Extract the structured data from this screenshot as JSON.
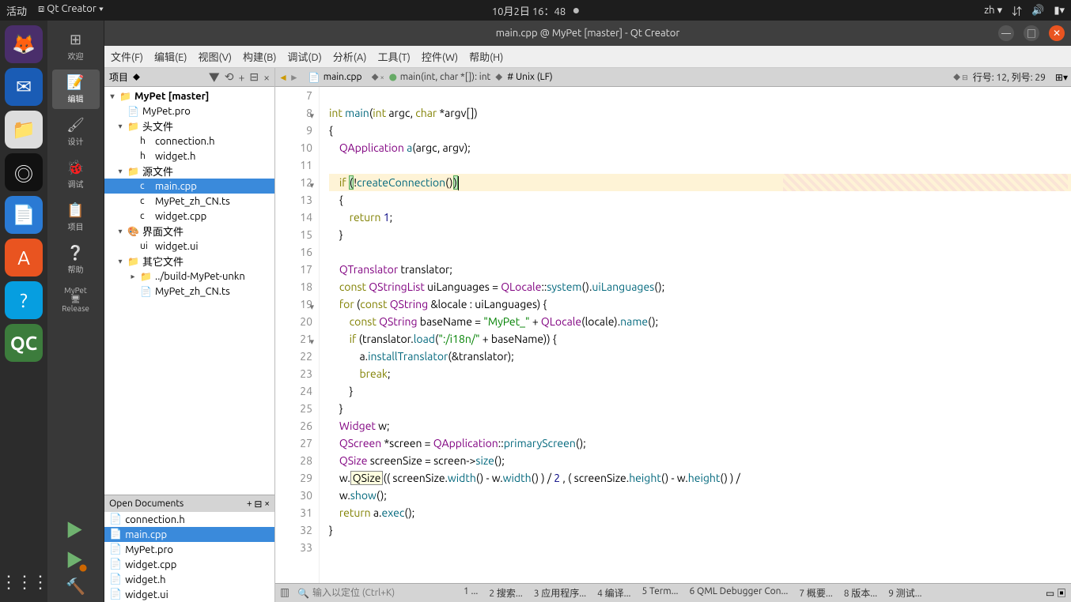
{
  "system": {
    "activities": "活动",
    "app_label": "Qt Creator ▾",
    "datetime": "10月2日  16：48",
    "lang": "zh ▾"
  },
  "window": {
    "title": "main.cpp @ MyPet [master] - Qt Creator"
  },
  "menu": [
    "文件(F)",
    "编辑(E)",
    "视图(V)",
    "构建(B)",
    "调试(D)",
    "分析(A)",
    "工具(T)",
    "控件(W)",
    "帮助(H)"
  ],
  "modebar_items": [
    {
      "icon": "⊞",
      "label": "欢迎"
    },
    {
      "icon": "📝",
      "label": "编辑",
      "active": true
    },
    {
      "icon": "🖌",
      "label": "设计"
    },
    {
      "icon": "🐞",
      "label": "调试"
    },
    {
      "icon": "📋",
      "label": "项目"
    },
    {
      "icon": "❔",
      "label": "帮助"
    }
  ],
  "kit": {
    "name": "MyPet",
    "config": "Release"
  },
  "project_panel": {
    "header": "项目",
    "tree": [
      {
        "depth": 0,
        "arrow": "▾",
        "icon": "📁",
        "label": "MyPet [master]",
        "bold": true
      },
      {
        "depth": 1,
        "arrow": "",
        "icon": "📄",
        "label": "MyPet.pro"
      },
      {
        "depth": 1,
        "arrow": "▾",
        "icon": "📁",
        "label": "头文件"
      },
      {
        "depth": 2,
        "arrow": "",
        "icon": "h",
        "label": "connection.h"
      },
      {
        "depth": 2,
        "arrow": "",
        "icon": "h",
        "label": "widget.h"
      },
      {
        "depth": 1,
        "arrow": "▾",
        "icon": "📁",
        "label": "源文件"
      },
      {
        "depth": 2,
        "arrow": "",
        "icon": "c",
        "label": "main.cpp",
        "selected": true
      },
      {
        "depth": 2,
        "arrow": "",
        "icon": "c",
        "label": "MyPet_zh_CN.ts"
      },
      {
        "depth": 2,
        "arrow": "",
        "icon": "c",
        "label": "widget.cpp"
      },
      {
        "depth": 1,
        "arrow": "▾",
        "icon": "🎨",
        "label": "界面文件"
      },
      {
        "depth": 2,
        "arrow": "",
        "icon": "ui",
        "label": "widget.ui"
      },
      {
        "depth": 1,
        "arrow": "▾",
        "icon": "📁",
        "label": "其它文件"
      },
      {
        "depth": 2,
        "arrow": "▸",
        "icon": "📁",
        "label": "../build-MyPet-unkn"
      },
      {
        "depth": 2,
        "arrow": "",
        "icon": "📄",
        "label": "MyPet_zh_CN.ts"
      }
    ]
  },
  "open_docs": {
    "header": "Open Documents",
    "items": [
      {
        "label": "connection.h"
      },
      {
        "label": "main.cpp",
        "selected": true
      },
      {
        "label": "MyPet.pro"
      },
      {
        "label": "widget.cpp"
      },
      {
        "label": "widget.h"
      },
      {
        "label": "widget.ui"
      }
    ]
  },
  "editor_toolbar": {
    "filename": "main.cpp",
    "symbol": "main(int, char *[]): int",
    "encoding": "#  Unix (LF)",
    "position": "行号: 12, 列号: 29"
  },
  "code_lines": [
    {
      "n": 7,
      "html": ""
    },
    {
      "n": 8,
      "fold": "▾",
      "html": "<span class='kw'>int</span> <span class='func'>main</span>(<span class='kw'>int</span> argc, <span class='kw'>char</span> *argv[])"
    },
    {
      "n": 9,
      "html": "{"
    },
    {
      "n": 10,
      "html": "    <span class='type'>QApplication</span> <span class='func'>a</span>(argc, argv);"
    },
    {
      "n": 11,
      "html": ""
    },
    {
      "n": 12,
      "fold": "▾",
      "hl": true,
      "html": "    <span class='kw'>if</span> <span class='paren-hl'>(</span>!<span class='func'>createConnection</span>()<span class='paren-hl'>)</span><span class='caret'></span>"
    },
    {
      "n": 13,
      "html": "    {"
    },
    {
      "n": 14,
      "html": "        <span class='kw'>return</span> <span class='num'>1</span>;"
    },
    {
      "n": 15,
      "html": "    }"
    },
    {
      "n": 16,
      "html": ""
    },
    {
      "n": 17,
      "html": "    <span class='type'>QTranslator</span> translator;"
    },
    {
      "n": 18,
      "html": "    <span class='kw'>const</span> <span class='type'>QStringList</span> uiLanguages = <span class='type'>QLocale</span>::<span class='func'>system</span>().<span class='func'>uiLanguages</span>();"
    },
    {
      "n": 19,
      "fold": "▾",
      "html": "    <span class='kw'>for</span> (<span class='kw'>const</span> <span class='type'>QString</span> &locale : uiLanguages) {"
    },
    {
      "n": 20,
      "html": "        <span class='kw'>const</span> <span class='type'>QString</span> baseName = <span class='str'>\"MyPet_\"</span> + <span class='type'>QLocale</span>(locale).<span class='func'>name</span>();"
    },
    {
      "n": 21,
      "fold": "▾",
      "html": "        <span class='kw'>if</span> (translator.<span class='func'>load</span>(<span class='str'>\":/i18n/\"</span> + baseName)) {"
    },
    {
      "n": 22,
      "html": "            a.<span class='func'>installTranslator</span>(&translator);"
    },
    {
      "n": 23,
      "html": "            <span class='kw'>break</span>;"
    },
    {
      "n": 24,
      "html": "        }"
    },
    {
      "n": 25,
      "html": "    }"
    },
    {
      "n": 26,
      "html": "    <span class='type'>Widget</span> w;"
    },
    {
      "n": 27,
      "html": "    <span class='type'>QScreen</span> *screen = <span class='type'>QApplication</span>::<span class='func'>primaryScreen</span>();"
    },
    {
      "n": 28,
      "html": "    <span class='type'>QSize</span> screenSize = screen-><span class='func'>size</span>();"
    },
    {
      "n": 29,
      "html": "    w.<span style='border:1px solid #888;background:#ffffe0;padding:0 2px'>QSize</span>(( screenSize.<span class='func'>width</span>() - w.<span class='func'>width</span>() ) / <span class='num'>2</span> , ( screenSize.<span class='func'>height</span>() - w.<span class='func'>height</span>() ) /"
    },
    {
      "n": 30,
      "html": "    w.<span class='func'>show</span>();"
    },
    {
      "n": 31,
      "html": "    <span class='kw'>return</span> a.<span class='func'>exec</span>();"
    },
    {
      "n": 32,
      "html": "}"
    },
    {
      "n": 33,
      "html": ""
    }
  ],
  "bottom_tabs": [
    "1  ...",
    "2  搜索...",
    "3  应用程序...",
    "4  编译...",
    "5  Term...",
    "6  QML Debugger Con...",
    "7  概要...",
    "8  版本...",
    "9  测试..."
  ],
  "locator_placeholder": "输入以定位 (Ctrl+K)"
}
